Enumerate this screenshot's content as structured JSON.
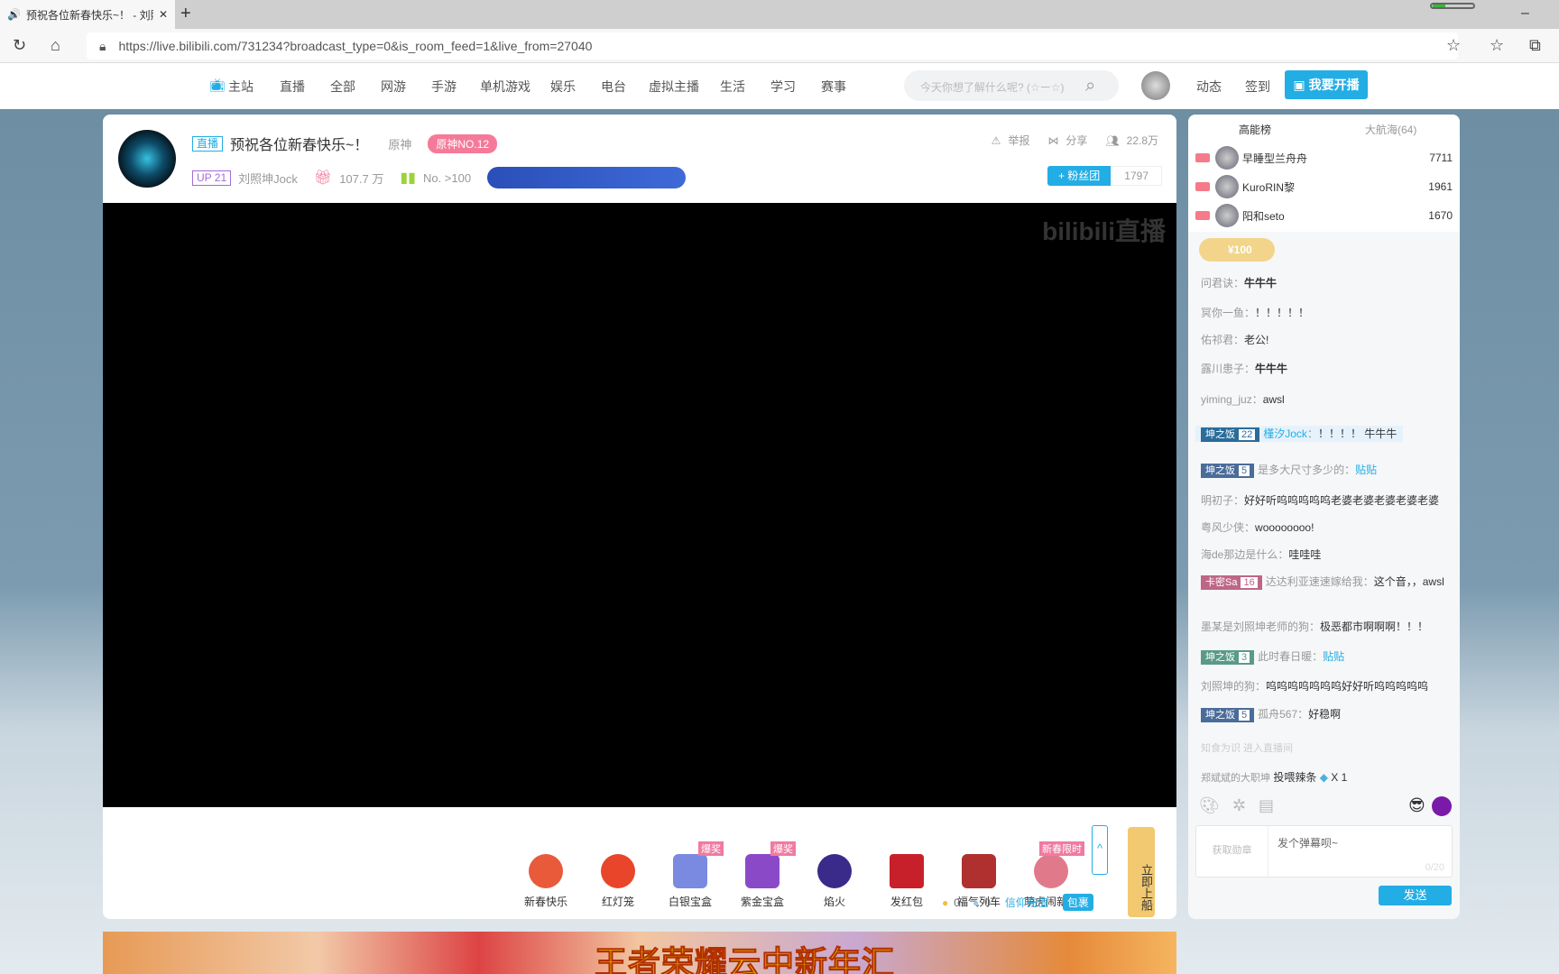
{
  "browser": {
    "tab_title": "预祝各位新春快乐~！ - 刘照",
    "url": "https://live.bilibili.com/731234?broadcast_type=0&is_room_feed=1&live_from=27040"
  },
  "nav": {
    "items": [
      "主站",
      "直播",
      "全部",
      "网游",
      "手游",
      "单机游戏",
      "娱乐",
      "电台",
      "虚拟主播",
      "生活",
      "学习",
      "赛事"
    ],
    "search_placeholder": "今天你想了解什么呢? (☆ー☆)",
    "dynamic": "动态",
    "checkin": "签到",
    "go_live": "我要开播"
  },
  "room": {
    "live_tag": "直播",
    "title": "预祝各位新春快乐~！",
    "area": "原神",
    "area_rank": "原神NO.12",
    "up_level": "UP 21",
    "streamer": "刘照坤Jock",
    "gifts": "107.7 万",
    "rank": "No. >100",
    "report": "举报",
    "share": "分享",
    "viewers": "22.8万",
    "fan_club": "+ 粉丝团",
    "fan_count": "1797",
    "watermark": "bilibili直播"
  },
  "gifts": [
    {
      "name": "新春快乐"
    },
    {
      "name": "红灯笼"
    },
    {
      "name": "白银宝盒",
      "badge": "爆奖"
    },
    {
      "name": "紫金宝盒",
      "badge": "爆奖"
    },
    {
      "name": "焰火"
    },
    {
      "name": "发红包"
    },
    {
      "name": "福气列车"
    },
    {
      "name": "萌虎闹新春",
      "badge": "新春限时"
    }
  ],
  "wallet": {
    "gold": "0",
    "silver": "0",
    "recharge": "信仰充值",
    "bag": "包裹",
    "board": "立即上船"
  },
  "ranking": {
    "tabs": [
      "高能榜",
      "大航海(64)"
    ],
    "rows": [
      {
        "name": "早睡型兰舟舟",
        "score": "7711"
      },
      {
        "name": "KuroRIN黎",
        "score": "1961"
      },
      {
        "name": "阳和seto",
        "score": "1670"
      }
    ],
    "gift_pill": "¥100"
  },
  "chat": [
    {
      "user": "问君诀",
      "text": "牛牛牛"
    },
    {
      "user": "冥你一鱼",
      "text": "！！！！！"
    },
    {
      "user": "佑祁君",
      "text": "老公!"
    },
    {
      "user": "露川患子",
      "text": "牛牛牛"
    },
    {
      "user": "yiming_juz",
      "text": "awsl"
    },
    {
      "medal": "坤之饭",
      "level": "22",
      "user": "槿汐Jock",
      "text": "！！！！ 牛牛牛"
    },
    {
      "medal": "坤之饭",
      "level": "5",
      "user": "是多大尺寸多少的",
      "text": "贴贴"
    },
    {
      "user": "明初子",
      "text": "好好听呜呜呜呜呜老婆老婆老婆老婆老婆"
    },
    {
      "user": "粤风少侠",
      "text": "woooooooo!"
    },
    {
      "user": "海de那边是什么",
      "text": "哇哇哇"
    },
    {
      "medal": "卡密Sa",
      "level": "16",
      "user": "达达利亚速速嫁给我",
      "text": "这个音，，awsl"
    },
    {
      "user": "墨某是刘照坤老师的狗",
      "text": "极恶都市啊啊啊！！！"
    },
    {
      "medal": "坤之饭",
      "level": "3",
      "user": "此时春日暖",
      "text": "贴贴"
    },
    {
      "user": "刘照坤的狗",
      "text": "呜呜呜呜呜呜呜好好听呜呜呜呜呜"
    },
    {
      "medal": "坤之饭",
      "level": "5",
      "user": "孤舟567",
      "text": "好稳啊"
    }
  ],
  "chat_footer": {
    "entry_notice": "知食为识 进入直播间",
    "gift_notice_user": "郑斌斌的大职坤",
    "gift_notice_text": "投喂辣条",
    "gift_count": "X 1",
    "input_placeholder": "发个弹幕呗~",
    "counter": "0/20",
    "medal_btn": "获取勋章",
    "send": "发送"
  },
  "banner": {
    "text": "王者荣耀云中新年汇"
  },
  "colors": {
    "brand": "#23ade5",
    "pink": "#f07aa0"
  }
}
